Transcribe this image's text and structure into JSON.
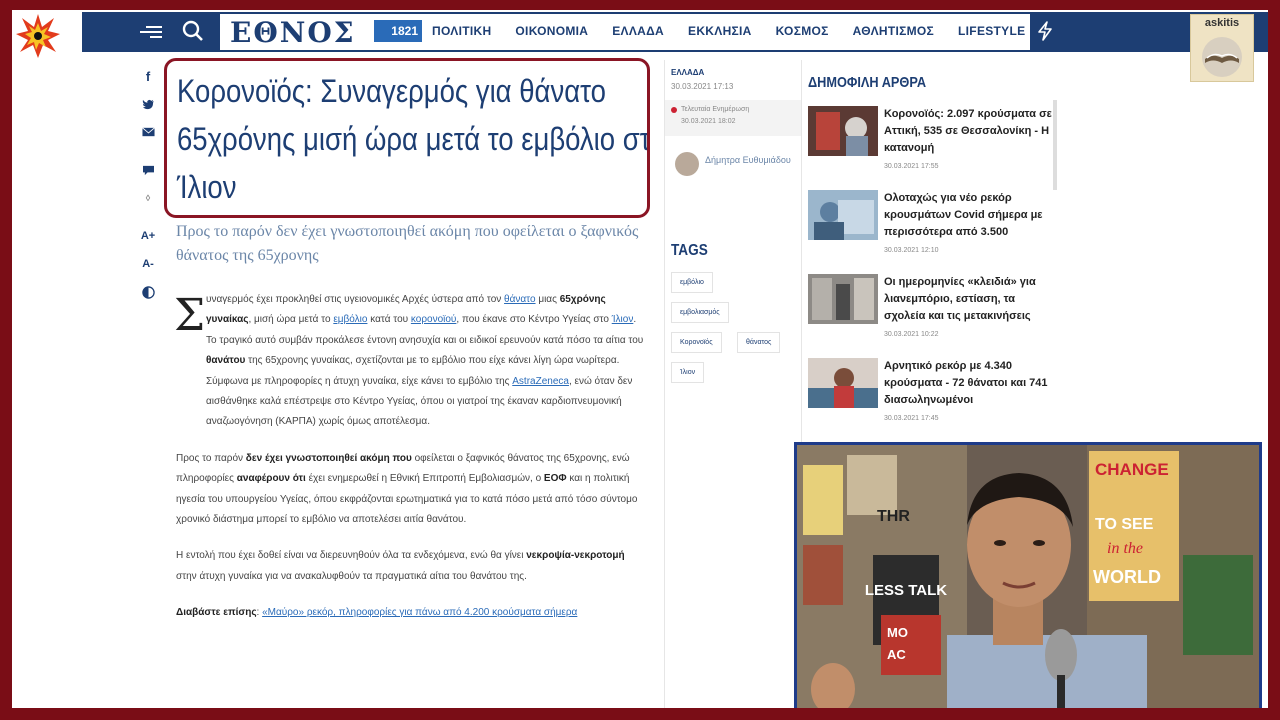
{
  "header": {
    "logo": "ΕΘΝΟΣ",
    "badge": "1821",
    "nav": [
      "ΠΟΛΙΤΙΚΗ",
      "ΟΙΚΟΝΟΜΙΑ",
      "ΕΛΛΑΔΑ",
      "ΕΚΚΛΗΣΙΑ",
      "ΚΟΣΜΟΣ",
      "ΑΘΛΗΤΙΣΜΟΣ",
      "LIFESTYLE"
    ]
  },
  "overlay": {
    "channel_label": "askitis"
  },
  "share": {
    "font_increase": "A+",
    "font_decrease": "A-"
  },
  "article": {
    "headline": "Κορονοϊός: Συναγερμός για θάνατο 65χρόνης μισή ώρα μετά το εμβόλιο στο Ίλιον",
    "lead": "Προς το παρόν δεν έχει γνωστοποιηθεί ακόμη που οφείλεται ο ξαφνικός θάνατος της 65χρονης",
    "dropcap": "Σ",
    "p1": {
      "a": "υναγερμός έχει προκληθεί στις υγειονομικές Αρχές ύστερα από τον ",
      "l1": "θάνατο",
      "b": " μιας ",
      "bold1": "65χρόνης γυναίκας",
      "c": ", μισή ώρα μετά το ",
      "l2": "εμβόλιο",
      "d": " κατά του ",
      "l3": "κορονοϊού",
      "e": ", που έκανε στο Κέντρο Υγείας στο ",
      "l4": "Ίλιον",
      "f": ". Το τραγικό αυτό συμβάν προκάλεσε έντονη ανησυχία και οι ειδικοί ερευνούν κατά πόσο τα αίτια του ",
      "bold2": "θανάτου",
      "g": " της 65χρονης γυναίκας, σχετίζονται με το εμβόλιο που είχε κάνει λίγη ώρα νωρίτερα. Σύμφωνα με πληροφορίες η άτυχη γυναίκα, είχε κάνει το εμβόλιο της ",
      "l5": "AstraZeneca",
      "h": ", ενώ όταν δεν αισθάνθηκε καλά επέστρεψε στο Κέντρο Υγείας, όπου οι γιατροί της έκαναν καρδιοπνευμονική αναζωογόνηση  (ΚΑΡΠΑ) χωρίς όμως αποτέλεσμα."
    },
    "p2": {
      "a": "Προς το παρόν ",
      "bold1": "δεν έχει γνωστοποιηθεί ακόμη που",
      "b": " οφείλεται ο ξαφνικός θάνατος της 65χρονης, ενώ πληροφορίες ",
      "bold2": "αναφέρουν ότι",
      "c": " έχει ενημερωθεί η Εθνική Επιτροπή Εμβολιασμών, ο ",
      "bold3": "ΕΟΦ",
      "d": " και η πολιτική ηγεσία του υπουργείου Υγείας, όπου εκφράζονται ερωτηματικά για το κατά πόσο μετά από τόσο σύντομο χρονικό διάστημα μπορεί το εμβόλιο να αποτελέσει αιτία θανάτου."
    },
    "p3": {
      "a": "Η εντολή που έχει δοθεί είναι να διερευνηθούν όλα τα ενδεχόμενα, ενώ θα γίνει ",
      "bold1": "νεκροψία-νεκροτομή",
      "b": " στην άτυχη γυναίκα για να ανακαλυφθούν τα πραγματικά αίτια του θανάτου της."
    },
    "p4": {
      "label": "Διαβάστε επίσης",
      "sep": ": ",
      "link": "«Μαύρο» ρεκόρ, πληροφορίες για πάνω από 4.200 κρούσματα σήμερα"
    }
  },
  "meta": {
    "category": "ΕΛΛΑΔΑ",
    "date": "30.03.2021  17:13",
    "updated_label": "Τελευταία Ενημέρωση",
    "updated_value": "30.03.2021  18:02",
    "author": "Δήμητρα Ευθυμιάδου"
  },
  "tags": {
    "title": "TAGS",
    "items": [
      "εμβόλιο",
      "εμβολιασμός",
      "Κορονοϊός",
      "θάνατος",
      "Ίλιον"
    ]
  },
  "popular": {
    "title": "ΔΗΜΟΦΙΛΗ ΑΡΘΡΑ",
    "items": [
      {
        "title": "Κορονοϊός: 2.097 κρούσματα σε Αττική, 535 σε Θεσσαλονίκη - Η κατανομή",
        "date": "30.03.2021   17:55"
      },
      {
        "title": "Ολοταχώς για νέο ρεκόρ κρουσμάτων Covid σήμερα με περισσότερα από 3.500",
        "date": "30.03.2021   12:10"
      },
      {
        "title": "Οι ημερομηνίες «κλειδιά» για λιανεμπόριο, εστίαση, τα σχολεία και τις μετακινήσεις",
        "date": "30.03.2021   10:22"
      },
      {
        "title": "Αρνητικό ρεκόρ με 4.340 κρούσματα - 72 θάνατοι και 741 διασωληνωμένοι",
        "date": "30.03.2021   17:45"
      }
    ]
  },
  "webcam": {
    "poster_words": [
      "THR",
      "LESS TALK",
      "CHANGE",
      "TO SEE",
      "in the",
      "WORLD",
      "MO",
      "AC"
    ]
  }
}
